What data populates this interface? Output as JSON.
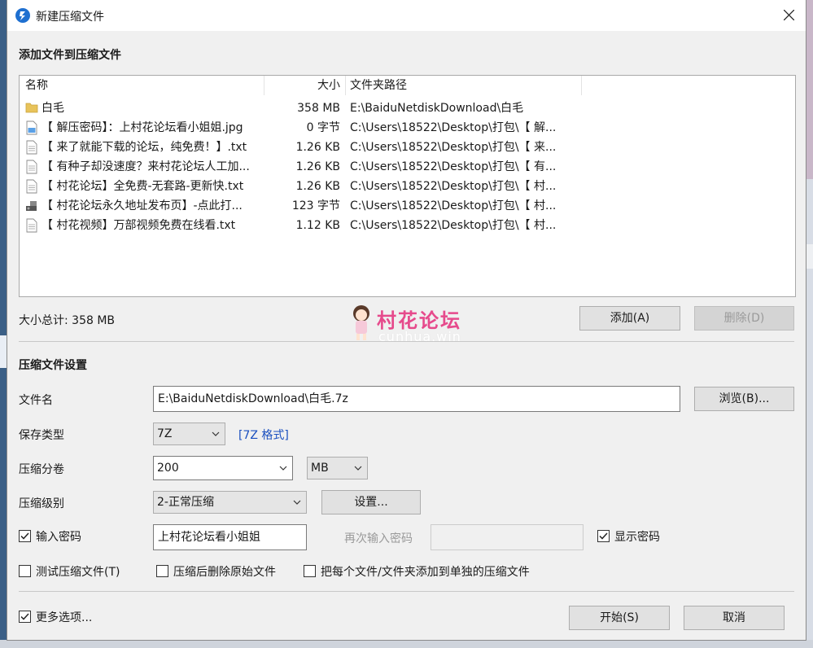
{
  "window": {
    "title": "新建压缩文件"
  },
  "add_section": {
    "title": "添加文件到压缩文件"
  },
  "file_list": {
    "columns": [
      "名称",
      "大小",
      "文件夹路径"
    ],
    "rows": [
      {
        "icon": "folder-icon",
        "name": "白毛",
        "size": "358 MB",
        "path": "E:\\BaiduNetdiskDownload\\白毛"
      },
      {
        "icon": "image-file-icon",
        "name": "【 解压密码】：上村花论坛看小姐姐.jpg",
        "size": "0 字节",
        "path": "C:\\Users\\18522\\Desktop\\打包\\【 解..."
      },
      {
        "icon": "text-file-icon",
        "name": "【 来了就能下载的论坛，纯免费！】.txt",
        "size": "1.26 KB",
        "path": "C:\\Users\\18522\\Desktop\\打包\\【 来..."
      },
      {
        "icon": "text-file-icon",
        "name": "【 有种子却没速度？来村花论坛人工加...",
        "size": "1.26 KB",
        "path": "C:\\Users\\18522\\Desktop\\打包\\【 有..."
      },
      {
        "icon": "text-file-icon",
        "name": "【 村花论坛】全免费-无套路-更新快.txt",
        "size": "1.26 KB",
        "path": "C:\\Users\\18522\\Desktop\\打包\\【 村..."
      },
      {
        "icon": "shortcut-file-icon",
        "name": "【 村花论坛永久地址发布页】-点此打...",
        "size": "123 字节",
        "path": "C:\\Users\\18522\\Desktop\\打包\\【 村..."
      },
      {
        "icon": "text-file-icon",
        "name": "【 村花视频】万部视频免费在线看.txt",
        "size": "1.12 KB",
        "path": "C:\\Users\\18522\\Desktop\\打包\\【 村..."
      }
    ]
  },
  "total_size": "大小总计: 358 MB",
  "buttons": {
    "add": "添加(A)",
    "delete": "删除(D)",
    "browse": "浏览(B)...",
    "settings": "设置...",
    "start": "开始(S)",
    "cancel": "取消"
  },
  "watermark": {
    "title": "村花论坛",
    "subtitle": "cunhua.win"
  },
  "settings_section": {
    "title": "压缩文件设置",
    "filename_label": "文件名",
    "filename_value": "E:\\BaiduNetdiskDownload\\白毛.7z",
    "save_type_label": "保存类型",
    "save_type_value": "7Z",
    "format_link": "[7Z 格式]",
    "split_label": "压缩分卷",
    "split_value": "200",
    "split_unit": "MB",
    "level_label": "压缩级别",
    "level_value": "2-正常压缩",
    "password_checkbox": "输入密码",
    "password_checked": true,
    "password_value": "上村花论坛看小姐姐",
    "reenter_label": "再次输入密码",
    "reenter_value": "",
    "show_password": "显示密码",
    "show_password_checked": true,
    "test_archive": "测试压缩文件(T)",
    "delete_after": "压缩后删除原始文件",
    "each_separate": "把每个文件/文件夹添加到单独的压缩文件",
    "more_options": "更多选项...",
    "more_options_checked": true
  }
}
